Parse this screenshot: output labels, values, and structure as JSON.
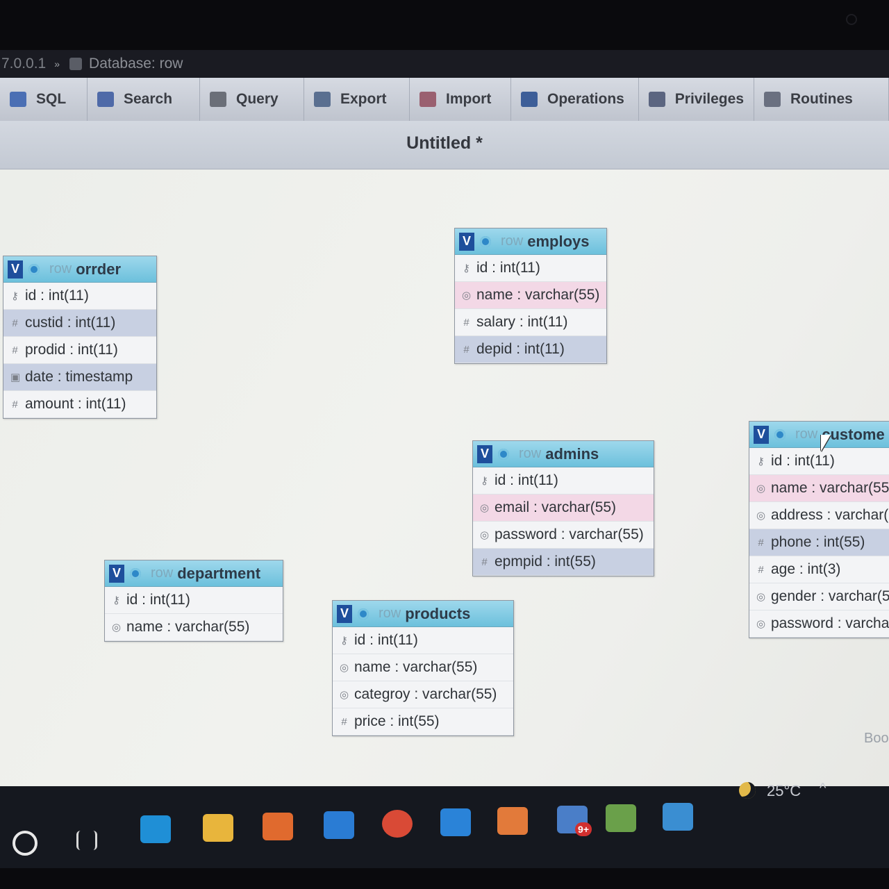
{
  "breadcrumb": {
    "server": "7.0.0.1",
    "separator": "»",
    "database": "Database: row"
  },
  "tabs": [
    {
      "label": "SQL",
      "icon": "sql-icon",
      "color": "#4b6fb4"
    },
    {
      "label": "Search",
      "icon": "search-icon",
      "color": "#4f6aa8"
    },
    {
      "label": "Query",
      "icon": "query-icon",
      "color": "#6b6f78"
    },
    {
      "label": "Export",
      "icon": "export-icon",
      "color": "#5a6f90"
    },
    {
      "label": "Import",
      "icon": "import-icon",
      "color": "#9a6070"
    },
    {
      "label": "Operations",
      "icon": "wrench-icon",
      "color": "#3d5e98"
    },
    {
      "label": "Privileges",
      "icon": "privileges-icon",
      "color": "#5b6580"
    },
    {
      "label": "Routines",
      "icon": "routines-icon",
      "color": "#6a7080"
    }
  ],
  "designer": {
    "title": "Untitled *",
    "db_prefix": "row",
    "more_label": "Boo"
  },
  "tables": [
    {
      "name": "orrder",
      "columns": [
        {
          "text": "id : int(11)",
          "icon": "key-icon",
          "hl": ""
        },
        {
          "text": "custid : int(11)",
          "icon": "hash-icon",
          "hl": "blue"
        },
        {
          "text": "prodid : int(11)",
          "icon": "hash-icon",
          "hl": ""
        },
        {
          "text": "date : timestamp",
          "icon": "date-icon",
          "hl": "blue"
        },
        {
          "text": "amount : int(11)",
          "icon": "hash-icon",
          "hl": ""
        }
      ]
    },
    {
      "name": "employs",
      "columns": [
        {
          "text": "id : int(11)",
          "icon": "key-icon",
          "hl": ""
        },
        {
          "text": "name : varchar(55)",
          "icon": "text-icon",
          "hl": "pink"
        },
        {
          "text": "salary : int(11)",
          "icon": "hash-icon",
          "hl": ""
        },
        {
          "text": "depid : int(11)",
          "icon": "hash-icon",
          "hl": "blue"
        }
      ]
    },
    {
      "name": "admins",
      "columns": [
        {
          "text": "id : int(11)",
          "icon": "key-icon",
          "hl": ""
        },
        {
          "text": "email : varchar(55)",
          "icon": "text-icon",
          "hl": "pink"
        },
        {
          "text": "password : varchar(55)",
          "icon": "text-icon",
          "hl": ""
        },
        {
          "text": "epmpid : int(55)",
          "icon": "hash-icon",
          "hl": "blue"
        }
      ]
    },
    {
      "name": "custome",
      "columns": [
        {
          "text": "id : int(11)",
          "icon": "key-icon",
          "hl": ""
        },
        {
          "text": "name : varchar(55)",
          "icon": "text-icon",
          "hl": "pink"
        },
        {
          "text": "address : varchar(5",
          "icon": "text-icon",
          "hl": ""
        },
        {
          "text": "phone : int(55)",
          "icon": "hash-icon",
          "hl": "blue"
        },
        {
          "text": "age : int(3)",
          "icon": "hash-icon",
          "hl": ""
        },
        {
          "text": "gender : varchar(5",
          "icon": "text-icon",
          "hl": ""
        },
        {
          "text": "password : varcha",
          "icon": "text-icon",
          "hl": ""
        }
      ]
    },
    {
      "name": "department",
      "columns": [
        {
          "text": "id : int(11)",
          "icon": "key-icon",
          "hl": ""
        },
        {
          "text": "name : varchar(55)",
          "icon": "text-icon",
          "hl": ""
        }
      ]
    },
    {
      "name": "products",
      "columns": [
        {
          "text": "id : int(11)",
          "icon": "key-icon",
          "hl": ""
        },
        {
          "text": "name : varchar(55)",
          "icon": "text-icon",
          "hl": ""
        },
        {
          "text": "categroy : varchar(55)",
          "icon": "text-icon",
          "hl": ""
        },
        {
          "text": "price : int(55)",
          "icon": "hash-icon",
          "hl": ""
        }
      ]
    }
  ],
  "taskbar": {
    "apps": [
      {
        "name": "start-circle-icon",
        "color": "#e8e8e8"
      },
      {
        "name": "task-view-icon",
        "color": "#d8d8d8"
      },
      {
        "name": "edge-icon",
        "color": "#1f8fd6"
      },
      {
        "name": "file-explorer-icon",
        "color": "#e8b53c"
      },
      {
        "name": "store-icon",
        "color": "#e06a2e"
      },
      {
        "name": "mail-icon",
        "color": "#2a7cd4"
      },
      {
        "name": "chrome-icon",
        "color": "#d94a36"
      },
      {
        "name": "vscode-icon",
        "color": "#2a83d8"
      },
      {
        "name": "xampp-icon",
        "color": "#e27a3a"
      },
      {
        "name": "notification-app-icon",
        "color": "#4a7ec8"
      },
      {
        "name": "sheet-app-icon",
        "color": "#6aa04a"
      },
      {
        "name": "photos-icon",
        "color": "#3a8ed2"
      }
    ],
    "badge": "9+",
    "temperature": "25°C",
    "caret": "^"
  }
}
